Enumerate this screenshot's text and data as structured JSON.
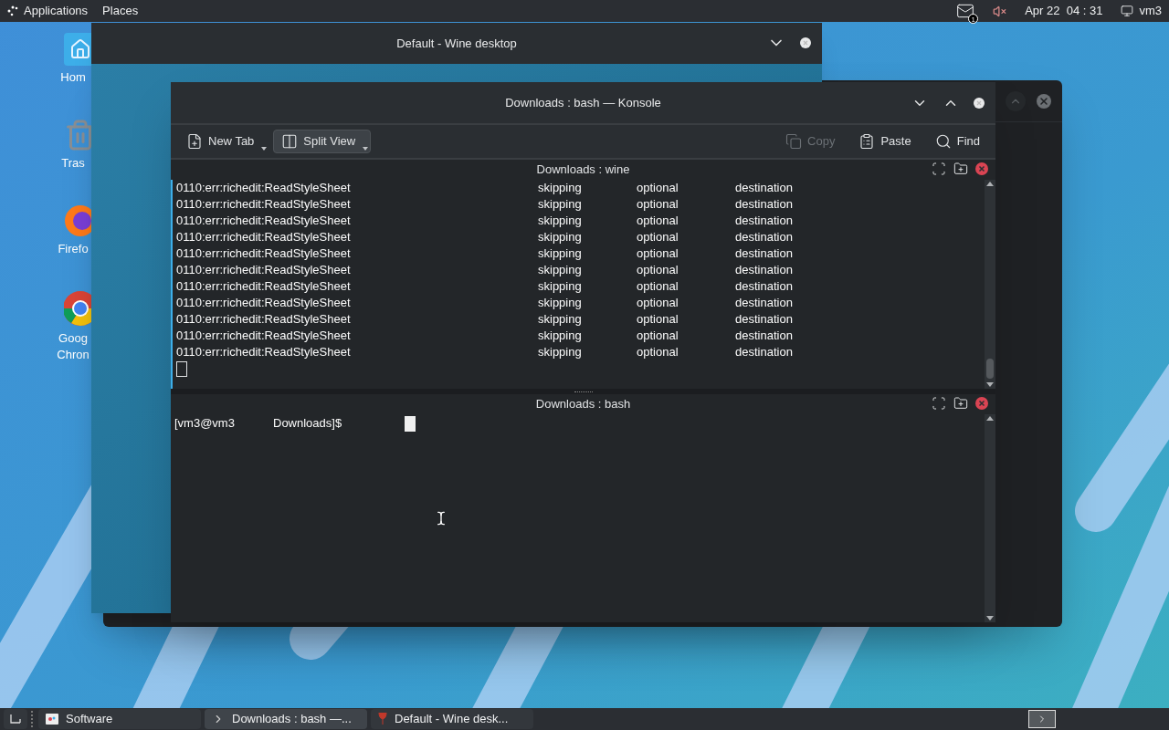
{
  "top_panel": {
    "menus": [
      "Applications",
      "Places"
    ],
    "mail_badge": "1",
    "clock": "Apr 22  04 : 31",
    "user": "vm3"
  },
  "desktop_icons": [
    {
      "label": "Hom"
    },
    {
      "label": "Tras"
    },
    {
      "label": "Firefo"
    },
    {
      "label": "Goog",
      "label_2": "Chron"
    }
  ],
  "wine_window": {
    "title": "Default - Wine desktop"
  },
  "konsole": {
    "title": "Downloads : bash — Konsole",
    "toolbar": [
      {
        "label": "New Tab",
        "kind": "dropdown",
        "selected": false,
        "disabled": false
      },
      {
        "label": "Split View",
        "kind": "dropdown",
        "selected": true,
        "disabled": false
      },
      {
        "label": "Copy",
        "kind": "action",
        "selected": false,
        "disabled": true
      },
      {
        "label": "Paste",
        "kind": "action",
        "selected": false,
        "disabled": false
      },
      {
        "label": "Find",
        "kind": "action",
        "selected": false,
        "disabled": false
      }
    ],
    "panes": [
      {
        "title": "Downloads : wine",
        "lines": [
          [
            "0110:err:richedit:ReadStyleSheet",
            "skipping",
            "optional",
            "destination"
          ],
          [
            "0110:err:richedit:ReadStyleSheet",
            "skipping",
            "optional",
            "destination"
          ],
          [
            "0110:err:richedit:ReadStyleSheet",
            "skipping",
            "optional",
            "destination"
          ],
          [
            "0110:err:richedit:ReadStyleSheet",
            "skipping",
            "optional",
            "destination"
          ],
          [
            "0110:err:richedit:ReadStyleSheet",
            "skipping",
            "optional",
            "destination"
          ],
          [
            "0110:err:richedit:ReadStyleSheet",
            "skipping",
            "optional",
            "destination"
          ],
          [
            "0110:err:richedit:ReadStyleSheet",
            "skipping",
            "optional",
            "destination"
          ],
          [
            "0110:err:richedit:ReadStyleSheet",
            "skipping",
            "optional",
            "destination"
          ],
          [
            "0110:err:richedit:ReadStyleSheet",
            "skipping",
            "optional",
            "destination"
          ],
          [
            "0110:err:richedit:ReadStyleSheet",
            "skipping",
            "optional",
            "destination"
          ],
          [
            "0110:err:richedit:ReadStyleSheet",
            "skipping",
            "optional",
            "destination"
          ]
        ],
        "cursor_filled": false
      },
      {
        "title": "Downloads : bash",
        "prompt": [
          "[vm3@vm3",
          "Downloads]$"
        ],
        "cursor_filled": true
      }
    ]
  },
  "taskbar": {
    "tasks": [
      {
        "label": "Software",
        "selected": false
      },
      {
        "label": "Downloads : bash —...",
        "selected": true
      },
      {
        "label": "Default - Wine desk...",
        "selected": false
      }
    ]
  }
}
